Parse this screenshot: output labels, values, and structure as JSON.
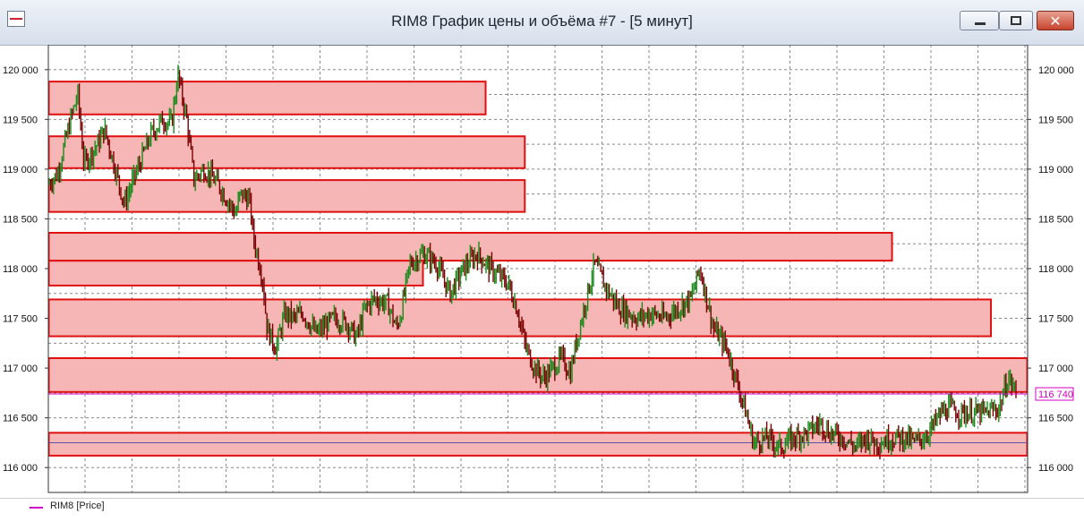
{
  "window": {
    "title": "RIM8 График цены и объёма #7 - [5 минут]",
    "close_glyph": "✕"
  },
  "legend": {
    "label": "RIM8 [Price]",
    "color": "#d400c8"
  },
  "chart_data": {
    "type": "candlestick",
    "ylim": [
      115750,
      120250
    ],
    "yticks": [
      116000,
      116500,
      117000,
      117500,
      118000,
      118500,
      119000,
      119500,
      120000
    ],
    "ytick_labels": [
      "116 000",
      "116 500",
      "117 000",
      "117 500",
      "118 000",
      "118 500",
      "119 000",
      "119 500",
      "120 000"
    ],
    "last_price": 116740,
    "last_price_label": "116 740",
    "grid": true,
    "colors": {
      "up": "#1a8a1a",
      "down": "#7a0000",
      "zone_fill": "#f7b6b6",
      "zone_border": "#e01010",
      "price_line": "#d400c8"
    },
    "zones": [
      {
        "low": 119550,
        "high": 119880,
        "end_x": 0.447
      },
      {
        "low": 119010,
        "high": 119330,
        "end_x": 0.487
      },
      {
        "low": 118570,
        "high": 118890,
        "end_x": 0.487
      },
      {
        "low": 117830,
        "high": 118080,
        "end_x": 0.383
      },
      {
        "low": 118080,
        "high": 118360,
        "end_x": 0.862
      },
      {
        "low": 117320,
        "high": 117690,
        "end_x": 0.963
      },
      {
        "low": 116760,
        "high": 117100,
        "end_x": 1.0
      },
      {
        "low": 116120,
        "high": 116350,
        "end_x": 1.0
      }
    ],
    "inner_line_price": 116250,
    "path_anchors": [
      [
        0.0,
        118850
      ],
      [
        0.01,
        118950
      ],
      [
        0.025,
        119500
      ],
      [
        0.033,
        119750
      ],
      [
        0.04,
        119050
      ],
      [
        0.055,
        119250
      ],
      [
        0.063,
        119400
      ],
      [
        0.075,
        119000
      ],
      [
        0.085,
        118650
      ],
      [
        0.1,
        119000
      ],
      [
        0.115,
        119350
      ],
      [
        0.128,
        119500
      ],
      [
        0.138,
        119450
      ],
      [
        0.145,
        119950
      ],
      [
        0.155,
        119500
      ],
      [
        0.163,
        118900
      ],
      [
        0.175,
        119000
      ],
      [
        0.19,
        118850
      ],
      [
        0.2,
        118700
      ],
      [
        0.21,
        118550
      ],
      [
        0.215,
        118750
      ],
      [
        0.225,
        118700
      ],
      [
        0.23,
        118300
      ],
      [
        0.24,
        117900
      ],
      [
        0.245,
        117400
      ],
      [
        0.255,
        117200
      ],
      [
        0.265,
        117550
      ],
      [
        0.275,
        117500
      ],
      [
        0.285,
        117550
      ],
      [
        0.3,
        117350
      ],
      [
        0.32,
        117500
      ],
      [
        0.335,
        117450
      ],
      [
        0.345,
        117300
      ],
      [
        0.355,
        117600
      ],
      [
        0.365,
        117700
      ],
      [
        0.38,
        117650
      ],
      [
        0.39,
        117400
      ],
      [
        0.395,
        117550
      ],
      [
        0.405,
        118050
      ],
      [
        0.42,
        118150
      ],
      [
        0.435,
        118050
      ],
      [
        0.45,
        117750
      ],
      [
        0.465,
        118000
      ],
      [
        0.48,
        118150
      ],
      [
        0.495,
        118000
      ],
      [
        0.515,
        117850
      ],
      [
        0.525,
        117600
      ],
      [
        0.535,
        117200
      ],
      [
        0.545,
        117000
      ],
      [
        0.555,
        116900
      ],
      [
        0.565,
        117000
      ],
      [
        0.575,
        117100
      ],
      [
        0.585,
        116950
      ],
      [
        0.59,
        117200
      ],
      [
        0.6,
        117600
      ],
      [
        0.612,
        118050
      ],
      [
        0.625,
        117800
      ],
      [
        0.64,
        117600
      ],
      [
        0.66,
        117500
      ],
      [
        0.675,
        117550
      ],
      [
        0.69,
        117500
      ],
      [
        0.705,
        117600
      ],
      [
        0.72,
        117700
      ],
      [
        0.73,
        118000
      ],
      [
        0.745,
        117400
      ],
      [
        0.76,
        117200
      ],
      [
        0.78,
        116600
      ],
      [
        0.79,
        116250
      ],
      [
        0.805,
        116300
      ],
      [
        0.82,
        116200
      ],
      [
        0.835,
        116300
      ],
      [
        0.85,
        116350
      ],
      [
        0.865,
        116450
      ],
      [
        0.875,
        116350
      ],
      [
        0.89,
        116300
      ],
      [
        0.905,
        116200
      ],
      [
        0.915,
        116300
      ],
      [
        0.93,
        116250
      ],
      [
        0.945,
        116300
      ],
      [
        0.96,
        116300
      ],
      [
        0.97,
        116250
      ],
      [
        0.98,
        116300
      ],
      [
        0.99,
        116400
      ],
      [
        1.0,
        116550
      ],
      [
        1.01,
        116600
      ],
      [
        1.02,
        116550
      ],
      [
        1.035,
        116550
      ],
      [
        1.05,
        116550
      ],
      [
        1.065,
        116600
      ],
      [
        1.075,
        116900
      ],
      [
        1.085,
        116750
      ]
    ]
  }
}
